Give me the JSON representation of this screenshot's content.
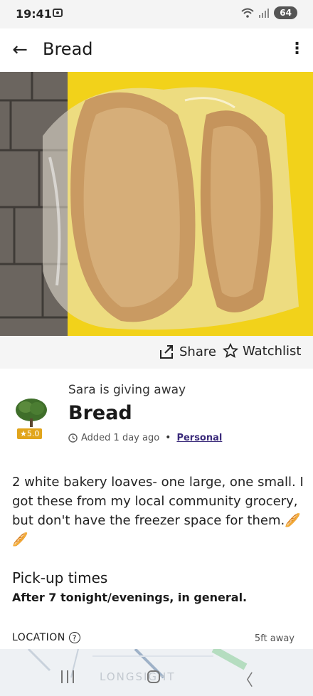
{
  "status_bar": {
    "time": "19:41",
    "battery": "64"
  },
  "app_bar": {
    "title": "Bread"
  },
  "actions": {
    "share_label": "Share",
    "watchlist_label": "Watchlist"
  },
  "listing": {
    "giver_line": "Sara is giving away",
    "title": "Bread",
    "rating": "5.0",
    "added": "Added 1 day ago",
    "category": "Personal",
    "description": "2 white bakery loaves- one large, one small. I got these from my local community grocery, but don't have the freezer space for them.🥖🥖",
    "pickup_heading": "Pick-up times",
    "pickup_times": "After 7 tonight/evenings, in general."
  },
  "location": {
    "label": "LOCATION",
    "distance": "5ft away",
    "map_text": "LONGSIGHT"
  },
  "colors": {
    "accent_purple": "#3a2a7a",
    "rating_gold": "#e1a51c",
    "photo_yellow": "#f2d21a"
  }
}
